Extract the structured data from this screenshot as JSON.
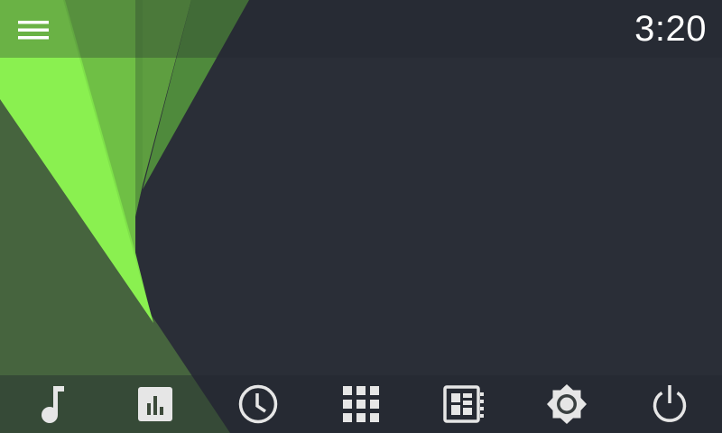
{
  "statusbar": {
    "time": "3:20"
  },
  "theme": {
    "background": "#2a2e37",
    "accent_bright": "#8af050",
    "accent_dark": "#46643e",
    "icon_color": "#e6e6e6"
  },
  "header": {
    "menu_icon": "hamburger-menu-icon"
  },
  "dock": {
    "items": [
      {
        "id": "music",
        "icon": "music-note-icon"
      },
      {
        "id": "equalizer",
        "icon": "bar-chart-icon"
      },
      {
        "id": "clock",
        "icon": "clock-icon"
      },
      {
        "id": "apps",
        "icon": "app-grid-icon"
      },
      {
        "id": "dashboard",
        "icon": "dashboard-icon"
      },
      {
        "id": "brightness",
        "icon": "brightness-icon"
      },
      {
        "id": "power",
        "icon": "power-icon"
      }
    ]
  }
}
